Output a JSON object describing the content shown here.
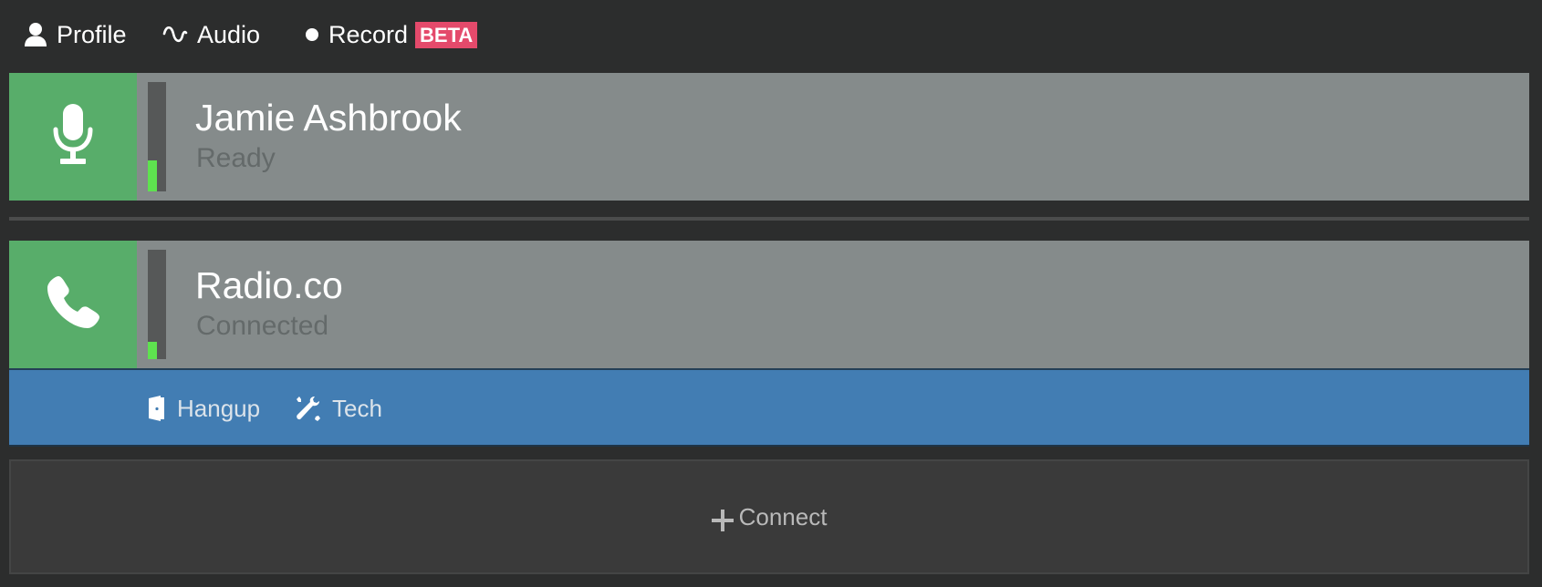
{
  "nav": {
    "profile": {
      "label": "Profile",
      "icon": "user-icon"
    },
    "audio": {
      "label": "Audio",
      "icon": "waveform-icon"
    },
    "record": {
      "label": "Record",
      "icon": "record-dot-icon",
      "badge": "BETA"
    }
  },
  "channels": [
    {
      "icon": "microphone-icon",
      "name": "Jamie Ashbrook",
      "status": "Ready",
      "meter_level": 0.28
    },
    {
      "icon": "phone-icon",
      "name": "Radio.co",
      "status": "Connected",
      "meter_level": 0.16
    }
  ],
  "actions": {
    "hangup": {
      "label": "Hangup",
      "icon": "door-exit-icon"
    },
    "tech": {
      "label": "Tech",
      "icon": "tools-icon"
    }
  },
  "connect": {
    "label": "Connect",
    "icon": "plus-icon"
  },
  "colors": {
    "background": "#2c2d2d",
    "card": "#858b8b",
    "icon_tile": "#58ad6a",
    "meter_fill": "#5ee24f",
    "action_bar": "#427db3",
    "beta_badge": "#e44a6b"
  }
}
